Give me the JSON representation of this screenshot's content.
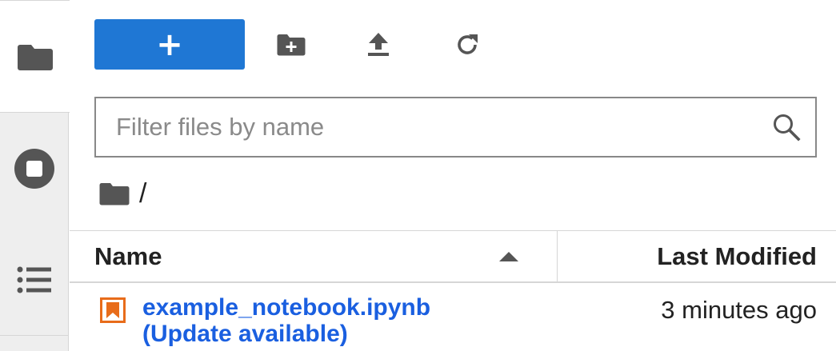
{
  "toolbar": {
    "new_launcher_label": "+",
    "icons": {
      "new_folder": "new-folder-icon",
      "upload": "upload-icon",
      "refresh": "refresh-icon"
    }
  },
  "activity_bar": {
    "tabs": [
      {
        "id": "files",
        "icon": "folder-icon",
        "active": true
      },
      {
        "id": "running",
        "icon": "stop-circle-icon",
        "active": false
      },
      {
        "id": "toc",
        "icon": "list-icon",
        "active": false
      }
    ]
  },
  "filter": {
    "placeholder": "Filter files by name",
    "value": ""
  },
  "breadcrumb": {
    "root_icon": "folder-icon",
    "path": "/"
  },
  "listing": {
    "columns": {
      "name": "Name",
      "modified": "Last Modified"
    },
    "sort": {
      "column": "name",
      "direction": "ascending"
    },
    "rows": [
      {
        "icon": "notebook-icon",
        "name": "example_notebook.ipynb",
        "status": "(Update available)",
        "modified": "3 minutes ago"
      }
    ]
  },
  "colors": {
    "accent": "#1f77d4",
    "link": "#1a5fe0",
    "notebook_icon": "#e86c1a",
    "icon_gray": "#555555"
  }
}
